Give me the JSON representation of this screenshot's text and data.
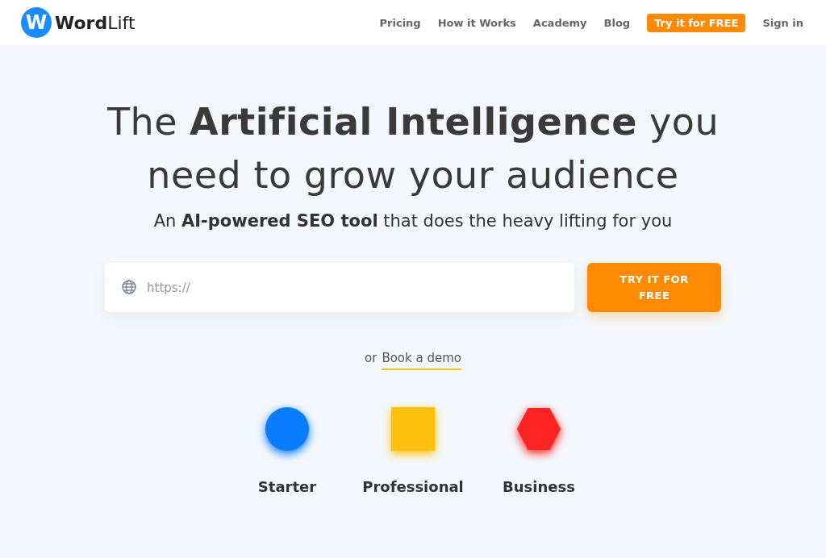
{
  "logo": {
    "mark": "W",
    "name": "Word",
    "name_suffix": "Lift"
  },
  "nav": [
    {
      "label": "Pricing",
      "kind": "link"
    },
    {
      "label": "How it Works",
      "kind": "link"
    },
    {
      "label": "Academy",
      "kind": "link"
    },
    {
      "label": "Blog",
      "kind": "link"
    },
    {
      "label": "Try it for FREE",
      "kind": "button"
    },
    {
      "label": "Sign in",
      "kind": "link"
    }
  ],
  "hero": {
    "headline": "The **Artificial Intelligence** you need to grow your audience",
    "subtitle": "An **AI-powered SEO tool** that does the heavy lifting for you"
  },
  "url_field": {
    "placeholder": "https://"
  },
  "cta_button": "TRY IT FOR FREE",
  "demo": {
    "prefix": "or",
    "link": "Book a demo"
  },
  "plans": [
    {
      "name": "Starter",
      "kind": "circle",
      "color": "#0a7cff"
    },
    {
      "name": "Professional",
      "kind": "square",
      "color": "#fcc00c"
    },
    {
      "name": "Business",
      "kind": "hexagon",
      "color": "#ff2424"
    }
  ]
}
